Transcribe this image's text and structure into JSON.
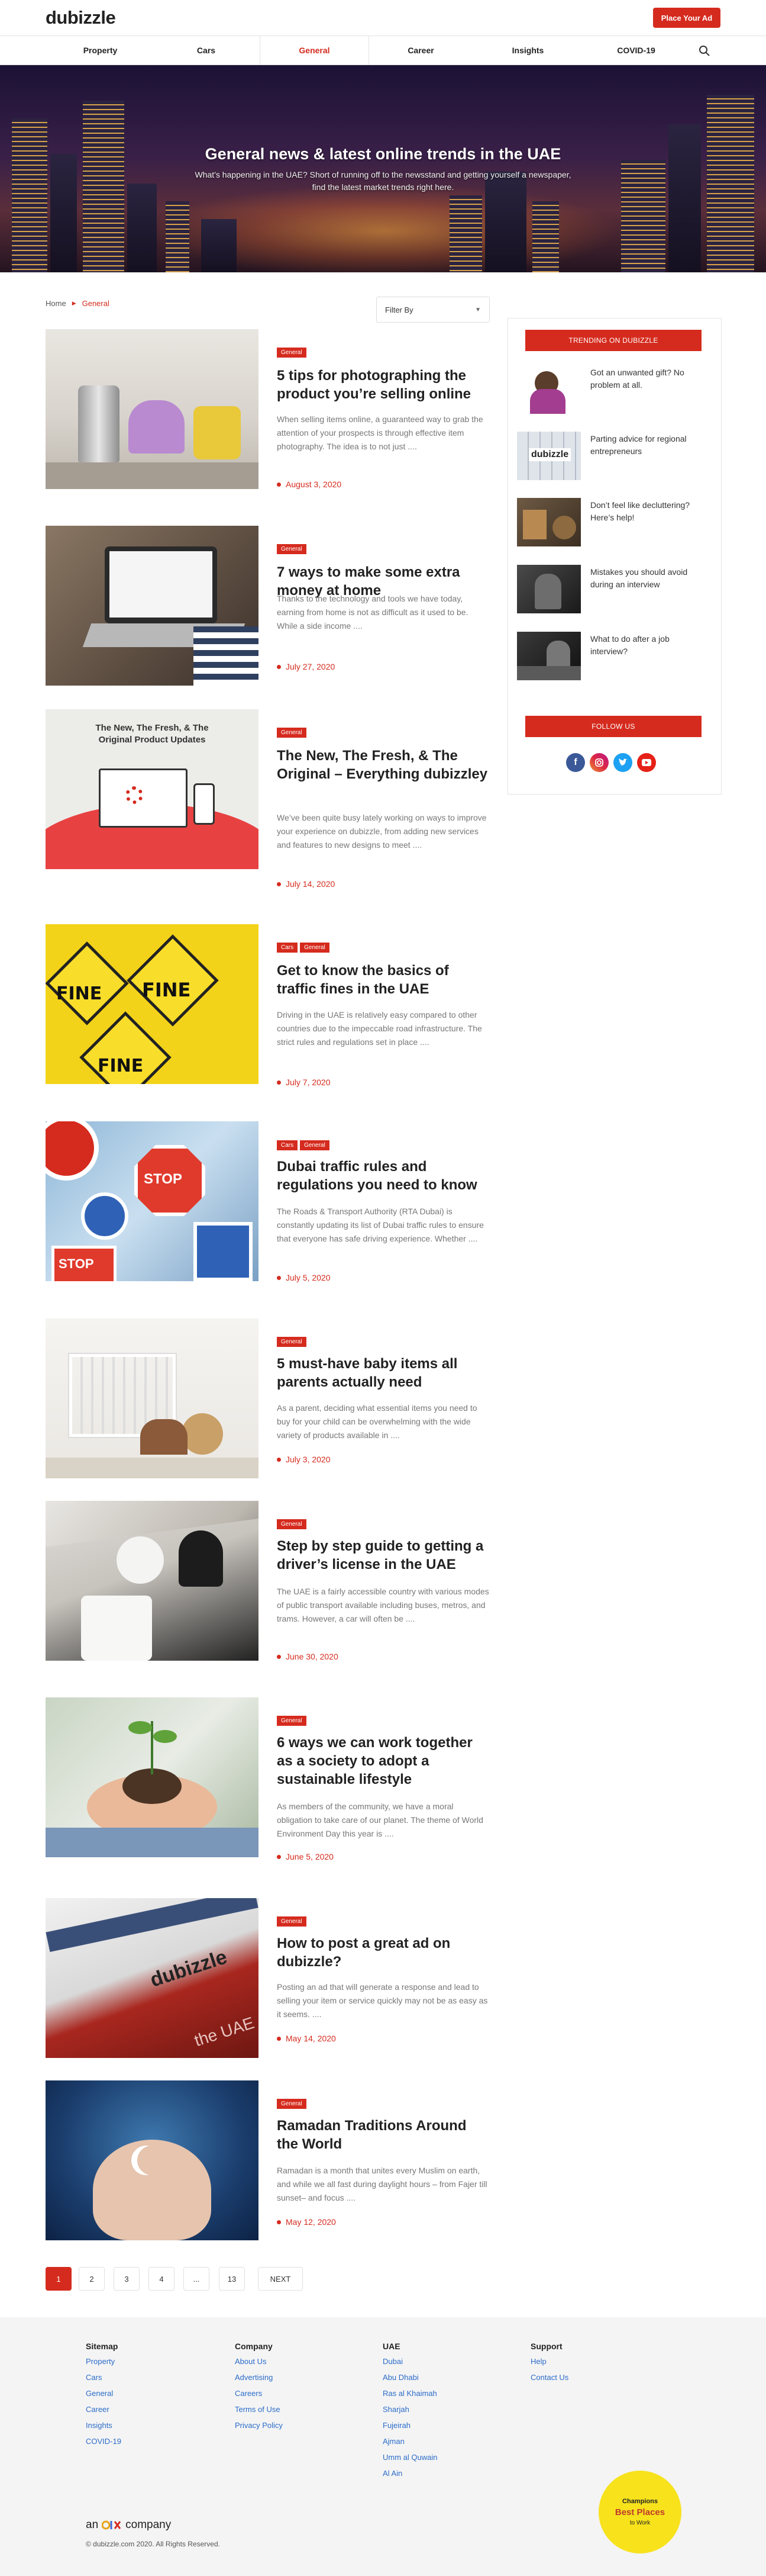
{
  "header": {
    "logo": "dubizzle",
    "place_ad": "Place Your Ad",
    "nav": [
      "Property",
      "Cars",
      "General",
      "Career",
      "Insights",
      "COVID-19"
    ],
    "active_nav": "General"
  },
  "hero": {
    "title": "General news & latest online trends in the UAE",
    "subtitle": "What's happening in the UAE? Short of running off to the newsstand and getting yourself a newspaper, find the latest market trends right here."
  },
  "breadcrumb": {
    "home": "Home",
    "current": "General"
  },
  "filter": {
    "label": "Filter By"
  },
  "articles": [
    {
      "tags": [
        "General"
      ],
      "title": "5 tips for photographing the product you’re selling online",
      "excerpt": "When selling items online, a guaranteed way to grab the attention of your prospects is through effective item photography.  The idea is to not just ....",
      "date": "August 3, 2020"
    },
    {
      "tags": [
        "General"
      ],
      "title": "7 ways to make some extra money at home",
      "excerpt": "Thanks to the technology and tools we have today, earning from home is not as difficult as it used to be. While a side income ....",
      "date": "July 27, 2020"
    },
    {
      "tags": [
        "General"
      ],
      "title": "The New, The Fresh, & The Original – Everything dubizzley",
      "excerpt": "We’ve been quite busy lately working on ways to improve your experience on dubizzle, from adding new services and features to new designs to meet ....",
      "date": "July 14, 2020"
    },
    {
      "tags": [
        "Cars",
        "General"
      ],
      "title": "Get to know the basics of traffic fines in the UAE",
      "excerpt": "Driving in the UAE is relatively easy compared to other countries due to the impeccable road infrastructure. The strict rules and regulations set in place ....",
      "date": "July 7, 2020"
    },
    {
      "tags": [
        "Cars",
        "General"
      ],
      "title": "Dubai traffic rules and regulations you need to know",
      "excerpt": "The Roads & Transport Authority (RTA Dubai) is constantly updating its list of Dubai traffic rules to ensure that everyone has safe driving experience. Whether ....",
      "date": "July 5, 2020"
    },
    {
      "tags": [
        "General"
      ],
      "title": "5 must-have baby items all parents actually need",
      "excerpt": "As a parent, deciding what essential items you need to buy for your child can be overwhelming with the wide variety of products available in ....",
      "date": "July 3, 2020"
    },
    {
      "tags": [
        "General"
      ],
      "title": "Step by step guide to getting a driver’s license in the UAE",
      "excerpt": "The UAE is a fairly accessible country with various modes of public transport available including buses, metros, and trams. However, a car will often be ....",
      "date": "June 30, 2020"
    },
    {
      "tags": [
        "General"
      ],
      "title": "6 ways we can work together as a society to adopt a sustainable lifestyle",
      "excerpt": "As members of the community, we have a moral obligation to take care of our planet. The theme of World Environment Day this year is ....",
      "date": "June 5, 2020"
    },
    {
      "tags": [
        "General"
      ],
      "title": "How to post a great ad on dubizzle?",
      "excerpt": "Posting an ad that will generate a response and lead to selling your item or service quickly may not be as easy as it seems. ....",
      "date": "May 14, 2020"
    },
    {
      "tags": [
        "General"
      ],
      "title": "Ramadan Traditions Around the World",
      "excerpt": "Ramadan is a month that unites every Muslim on earth, and while we all fast during daylight hours – from Fajer till sunset– and focus ....",
      "date": "May 12, 2020"
    }
  ],
  "article_image_texts": {
    "promo_heading": "The New, The Fresh, & The Original Product Updates",
    "fine": "FINE",
    "stop": "STOP",
    "dubizzle_screen": "dubizzle",
    "uae_screen": "the UAE"
  },
  "sidebar": {
    "trending_title": "TRENDING ON DUBIZZLE",
    "trending": [
      "Got an unwanted gift? No problem at all.",
      "Parting advice for regional entrepreneurs",
      "Don’t feel like decluttering? Here’s help!",
      "Mistakes you should avoid during an interview",
      "What to do after a job interview?"
    ],
    "trending_thumb_logo": "dubizzle",
    "follow_title": "FOLLOW US",
    "social": [
      "facebook",
      "instagram",
      "twitter",
      "youtube"
    ]
  },
  "pagination": [
    "1",
    "2",
    "3",
    "4",
    "...",
    "13",
    "NEXT"
  ],
  "pagination_active": "1",
  "footer": {
    "columns": [
      {
        "heading": "Sitemap",
        "links": [
          "Property",
          "Cars",
          "General",
          "Career",
          "Insights",
          "COVID-19"
        ]
      },
      {
        "heading": "Company",
        "links": [
          "About Us",
          "Advertising",
          "Careers",
          "Terms of Use",
          "Privacy Policy"
        ]
      },
      {
        "heading": "UAE",
        "links": [
          "Dubai",
          "Abu Dhabi",
          "Ras al Khaimah",
          "Sharjah",
          "Fujeirah",
          "Ajman",
          "Umm al Quwain",
          "Al Ain"
        ]
      },
      {
        "heading": "Support",
        "links": [
          "Help",
          "Contact Us"
        ]
      }
    ],
    "brand_prefix": "an",
    "brand_suffix": "company",
    "copyright": "© dubizzle.com 2020. All Rights Reserved.",
    "badge": {
      "line1": "Champions",
      "line2": "Best Places",
      "line3": "to Work"
    }
  },
  "colors": {
    "brand_red": "#d52b1e",
    "link_blue": "#2b6cc9",
    "footer_bg": "#f4f4f4"
  }
}
